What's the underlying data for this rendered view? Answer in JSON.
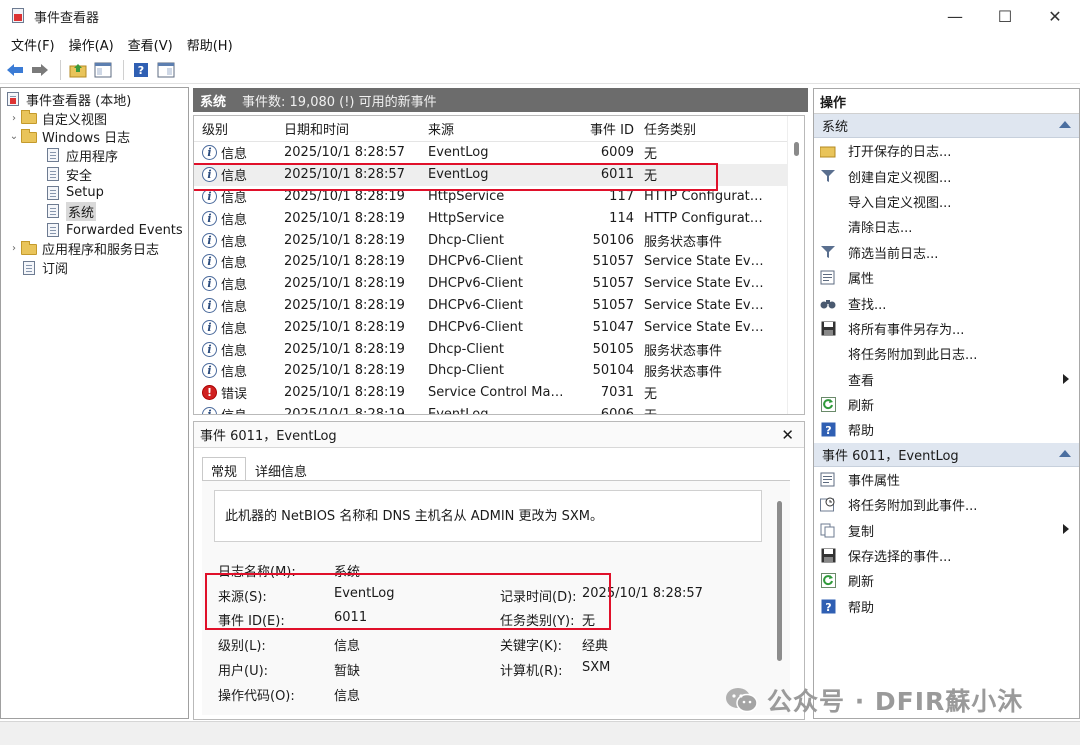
{
  "window": {
    "title": "事件查看器",
    "minimize": "—",
    "maximize": "☐",
    "close": "✕"
  },
  "menu": [
    "文件(F)",
    "操作(A)",
    "查看(V)",
    "帮助(H)"
  ],
  "tree": {
    "root": "事件查看器 (本地)",
    "custom_views": "自定义视图",
    "windows_logs": "Windows 日志",
    "application": "应用程序",
    "security": "安全",
    "setup": "Setup",
    "system": "系统",
    "forwarded": "Forwarded Events",
    "app_services": "应用程序和服务日志",
    "subscriptions": "订阅"
  },
  "center": {
    "title": "系统",
    "info": "事件数: 19,080 (!) 可用的新事件",
    "columns": [
      "级别",
      "日期和时间",
      "来源",
      "事件 ID",
      "任务类别"
    ],
    "rows": [
      {
        "level": "信息",
        "type": "info",
        "time": "2025/10/1 8:28:57",
        "source": "EventLog",
        "id": "6009",
        "task": "无"
      },
      {
        "level": "信息",
        "type": "info",
        "time": "2025/10/1 8:28:57",
        "source": "EventLog",
        "id": "6011",
        "task": "无"
      },
      {
        "level": "信息",
        "type": "info",
        "time": "2025/10/1 8:28:19",
        "source": "HttpService",
        "id": "117",
        "task": "HTTP Configuration..."
      },
      {
        "level": "信息",
        "type": "info",
        "time": "2025/10/1 8:28:19",
        "source": "HttpService",
        "id": "114",
        "task": "HTTP Configuration..."
      },
      {
        "level": "信息",
        "type": "info",
        "time": "2025/10/1 8:28:19",
        "source": "Dhcp-Client",
        "id": "50106",
        "task": "服务状态事件"
      },
      {
        "level": "信息",
        "type": "info",
        "time": "2025/10/1 8:28:19",
        "source": "DHCPv6-Client",
        "id": "51057",
        "task": "Service State Event"
      },
      {
        "level": "信息",
        "type": "info",
        "time": "2025/10/1 8:28:19",
        "source": "DHCPv6-Client",
        "id": "51057",
        "task": "Service State Event"
      },
      {
        "level": "信息",
        "type": "info",
        "time": "2025/10/1 8:28:19",
        "source": "DHCPv6-Client",
        "id": "51057",
        "task": "Service State Event"
      },
      {
        "level": "信息",
        "type": "info",
        "time": "2025/10/1 8:28:19",
        "source": "DHCPv6-Client",
        "id": "51047",
        "task": "Service State Event"
      },
      {
        "level": "信息",
        "type": "info",
        "time": "2025/10/1 8:28:19",
        "source": "Dhcp-Client",
        "id": "50105",
        "task": "服务状态事件"
      },
      {
        "level": "信息",
        "type": "info",
        "time": "2025/10/1 8:28:19",
        "source": "Dhcp-Client",
        "id": "50104",
        "task": "服务状态事件"
      },
      {
        "level": "错误",
        "type": "error",
        "time": "2025/10/1 8:28:19",
        "source": "Service Control Man...",
        "id": "7031",
        "task": "无"
      },
      {
        "level": "信息",
        "type": "info",
        "time": "2025/10/1 8:28:19",
        "source": "EventLog",
        "id": "6006",
        "task": "无"
      }
    ]
  },
  "detail": {
    "header": "事件 6011，EventLog",
    "tab_general": "常规",
    "tab_details": "详细信息",
    "description": "此机器的 NetBIOS 名称和 DNS 主机名从 ADMIN 更改为 SXM。",
    "log_name_label": "日志名称(M):",
    "log_name": "系统",
    "source_label": "来源(S):",
    "source": "EventLog",
    "logged_label": "记录时间(D):",
    "logged": "2025/10/1 8:28:57",
    "event_id_label": "事件 ID(E):",
    "event_id": "6011",
    "task_label": "任务类别(Y):",
    "task": "无",
    "level_label": "级别(L):",
    "level": "信息",
    "keywords_label": "关键字(K):",
    "keywords": "经典",
    "user_label": "用户(U):",
    "user": "暂缺",
    "computer_label": "计算机(R):",
    "computer": "SXM",
    "opcode_label": "操作代码(O):",
    "opcode": "信息"
  },
  "actions": {
    "title": "操作",
    "section1": "系统",
    "items1": [
      "打开保存的日志...",
      "创建自定义视图...",
      "导入自定义视图...",
      "清除日志...",
      "筛选当前日志...",
      "属性",
      "查找...",
      "将所有事件另存为...",
      "将任务附加到此日志...",
      "查看",
      "刷新",
      "帮助"
    ],
    "section2": "事件 6011，EventLog",
    "items2": [
      "事件属性",
      "将任务附加到此事件...",
      "复制",
      "保存选择的事件...",
      "刷新",
      "帮助"
    ]
  },
  "watermark": "公众号 · DFIR蘇小沐"
}
